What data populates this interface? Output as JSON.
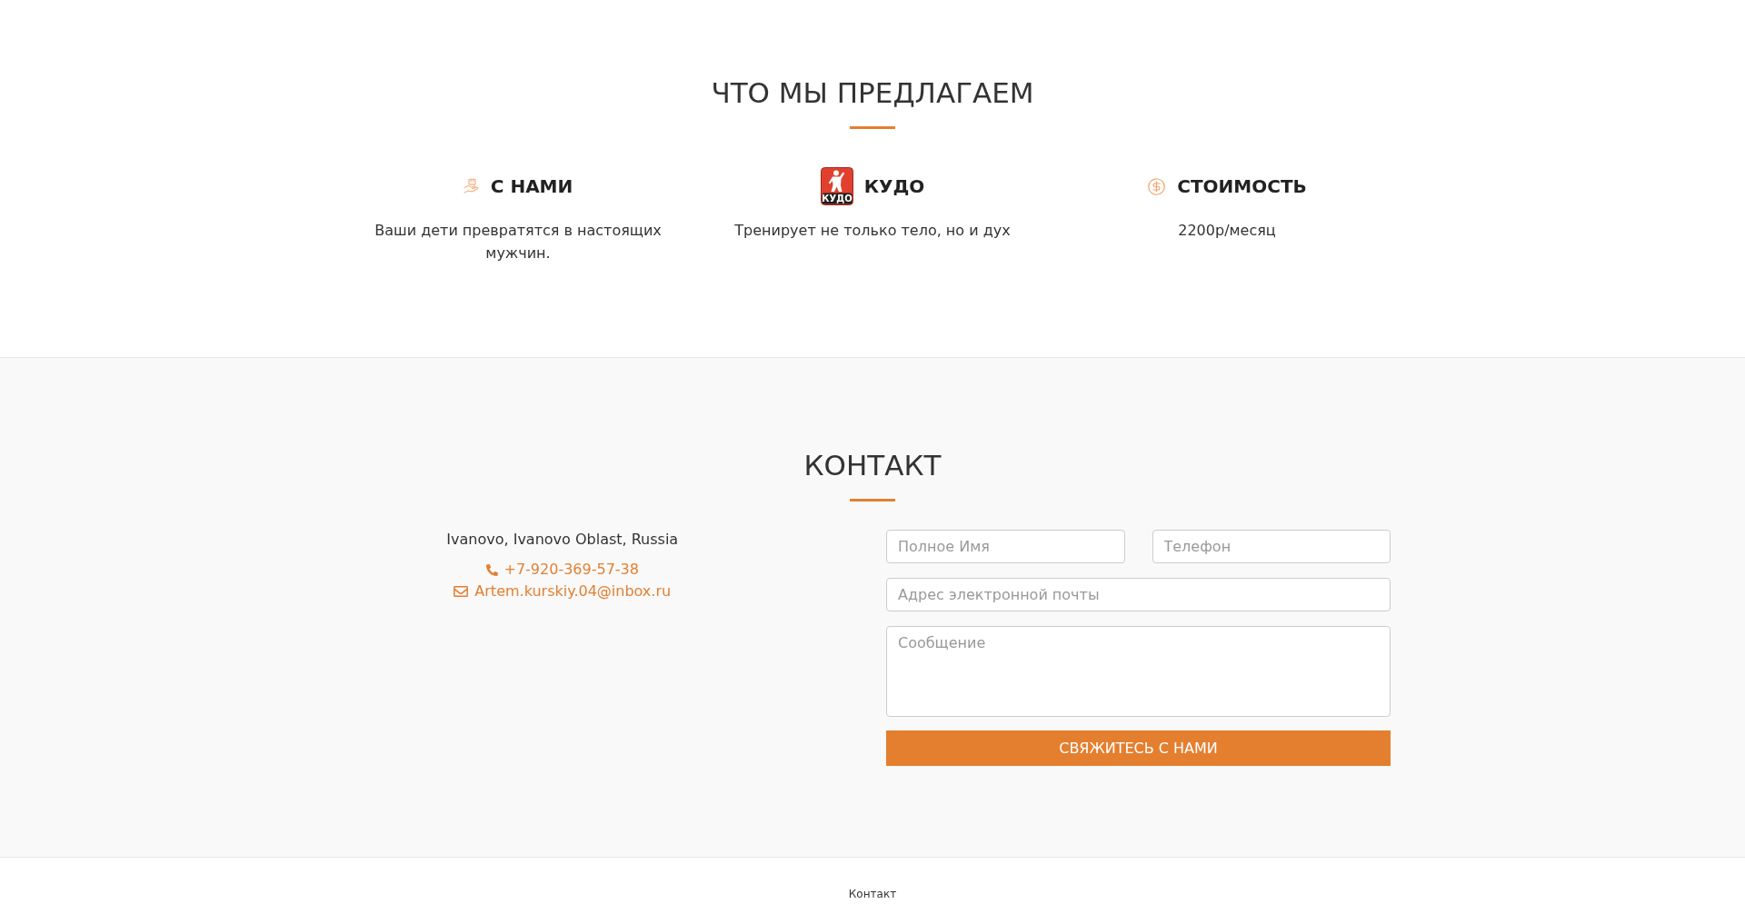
{
  "offer": {
    "title": "ЧТО МЫ ПРЕДЛАГАЕМ",
    "features": [
      {
        "kind": "hands",
        "title": "С НАМИ",
        "text": "Ваши дети превратятся в настоящих мужчин."
      },
      {
        "kind": "logo",
        "logo_text": "КУДО",
        "title": "КУДО",
        "text": "Тренирует не только тело, но и дух"
      },
      {
        "kind": "price",
        "title": "СТОИМОСТЬ",
        "text": "2200р/месяц"
      }
    ]
  },
  "contact": {
    "title": "КОНТАКТ",
    "address": "Ivanovo, Ivanovo Oblast, Russia",
    "phone": "+7-920-369-57-38",
    "email": "Artem.kurskiy.04@inbox.ru",
    "form": {
      "name": {
        "placeholder": "Полное Имя"
      },
      "phone": {
        "placeholder": "Телефон"
      },
      "email": {
        "placeholder": "Адрес электронной почты"
      },
      "message": {
        "placeholder": "Сообщение"
      },
      "submit": "СВЯЖИТЕСЬ С НАМИ"
    }
  },
  "footer": {
    "links": [
      "Контакт"
    ]
  }
}
